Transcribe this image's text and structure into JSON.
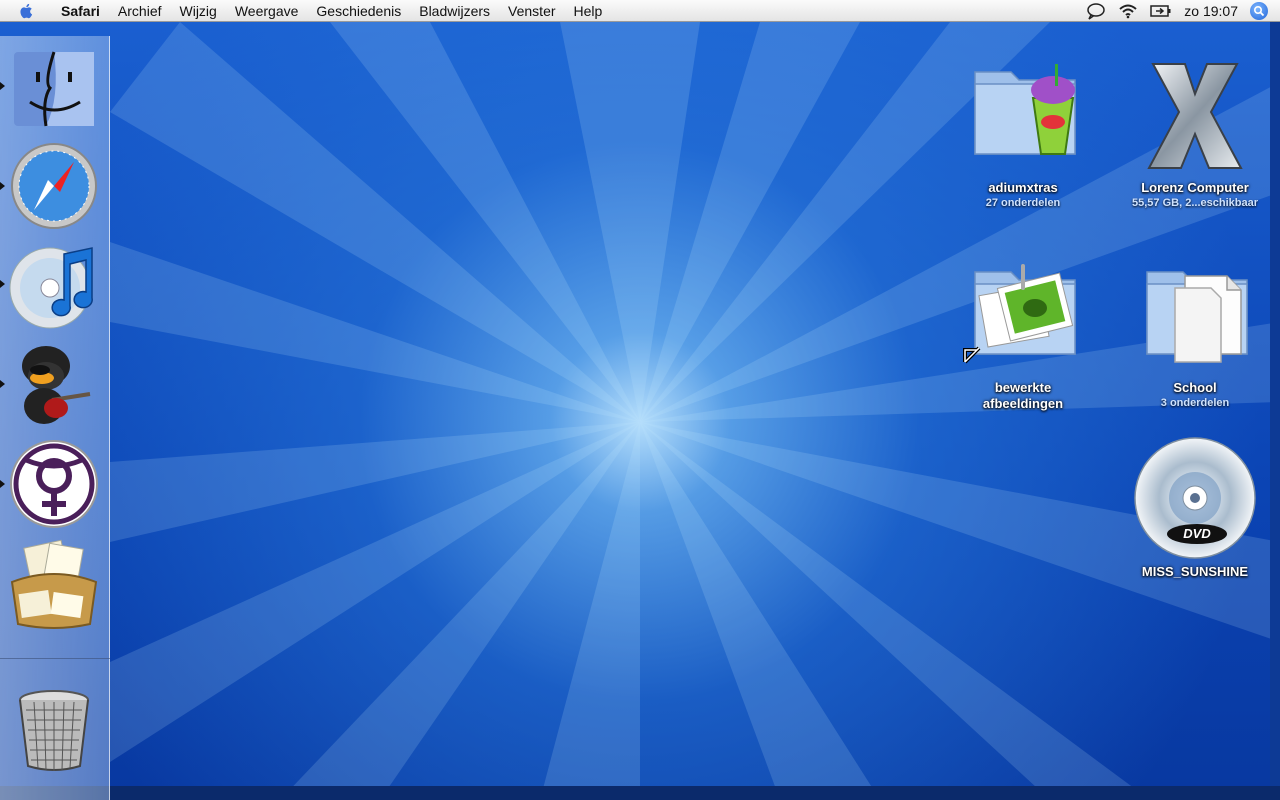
{
  "menubar": {
    "app_name": "Safari",
    "items": [
      "Archief",
      "Wijzig",
      "Weergave",
      "Geschiedenis",
      "Bladwijzers",
      "Venster",
      "Help"
    ],
    "clock": "zo 19:07",
    "status_icons": [
      "ichat-status-icon",
      "wifi-icon",
      "battery-icon",
      "spotlight-icon"
    ]
  },
  "dock": {
    "items": [
      {
        "name": "finder",
        "running": true
      },
      {
        "name": "safari",
        "running": true
      },
      {
        "name": "itunes",
        "running": true
      },
      {
        "name": "adium",
        "running": true
      },
      {
        "name": "venus-app",
        "running": true
      },
      {
        "name": "mail",
        "running": false
      }
    ],
    "trash": "trash"
  },
  "desktop": {
    "icons": [
      {
        "label": "adiumxtras",
        "sub": "27 onderdelen"
      },
      {
        "label": "Lorenz Computer",
        "sub": "55,57 GB, 2...eschikbaar"
      },
      {
        "label": "bewerkte",
        "label2": "afbeeldingen",
        "sub": ""
      },
      {
        "label": "School",
        "sub": "3 onderdelen"
      },
      {
        "label": "MISS_SUNSHINE",
        "sub": ""
      }
    ]
  },
  "colors": {
    "desktop_blue": "#0b44b4",
    "center_glow": "#bee6ff"
  }
}
